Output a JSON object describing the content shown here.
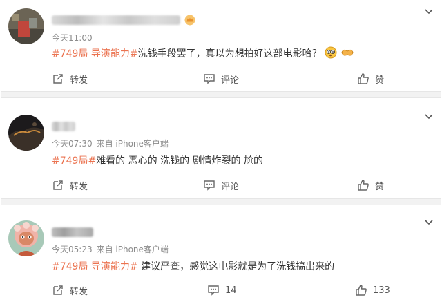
{
  "posts": [
    {
      "time": "今天11:00",
      "source": "",
      "tag": "#749局 导演能力#",
      "body": "洗钱手段罢了，真以为想拍好这部电影哈？",
      "actions": {
        "repost": "转发",
        "comment": "评论",
        "like": "赞"
      }
    },
    {
      "time": "今天07:30",
      "source": "来自 iPhone客户端",
      "tag": "#749局#",
      "body": "难看的 恶心的 洗钱的 剧情炸裂的 尬的",
      "actions": {
        "repost": "转发",
        "comment": "评论",
        "like": "赞"
      }
    },
    {
      "time": "今天05:23",
      "source": "来自 iPhone客户端",
      "tag": "#749局 导演能力#",
      "body": " 建议严查，感觉这电影就是为了洗钱搞出来的",
      "actions": {
        "repost": "转发",
        "comment": "14",
        "like": "133"
      }
    }
  ],
  "icons": [
    "chevron-down-icon",
    "repost-icon",
    "comment-icon",
    "thumb-up-icon",
    "avatar",
    "vip-crown-icon",
    "emoji-icon"
  ],
  "colors": {
    "tag": "#eb7350",
    "meta": "#8c8c8c",
    "text": "#333333",
    "separator": "#f2f2f2"
  }
}
